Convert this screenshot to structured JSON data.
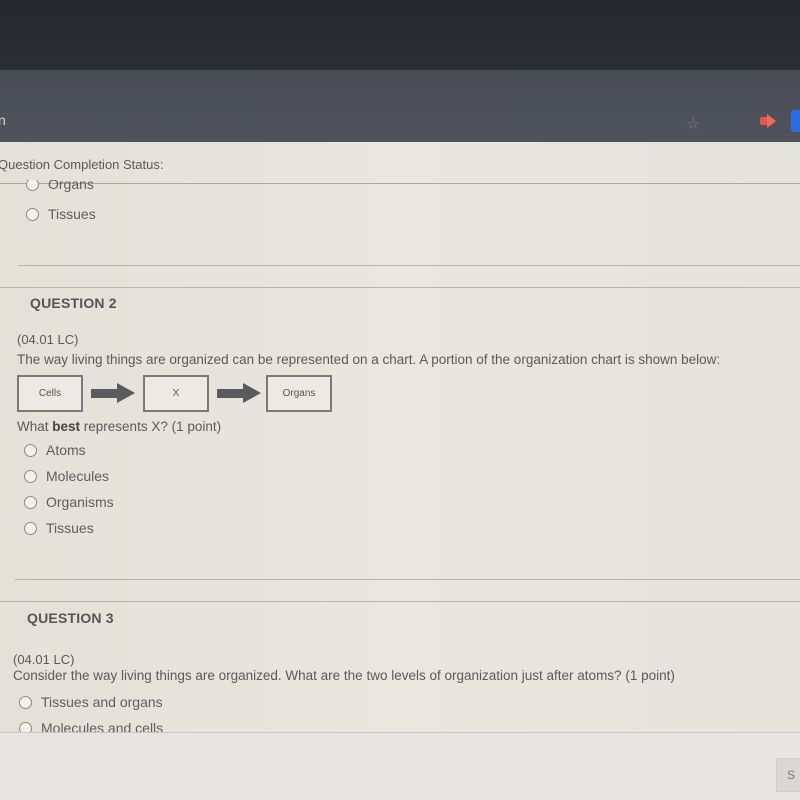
{
  "browser": {
    "tab_edge_glyph": "n",
    "star_icon": "☆",
    "extensions": [
      "red-arrow-extension-icon",
      "blue-extension-icon"
    ]
  },
  "status": {
    "label": "Question Completion Status:"
  },
  "question1_tail": {
    "options": [
      "Organs",
      "Tissues"
    ]
  },
  "question2": {
    "title": "QUESTION 2",
    "code": "(04.01 LC)",
    "text": "The way living things are organized can be represented on a chart. A portion of the organization chart is shown below:",
    "chart": {
      "boxes": [
        "Cells",
        "X",
        "Organs"
      ]
    },
    "prompt_pre": "What ",
    "prompt_bold": "best",
    "prompt_post": " represents X? (1 point)",
    "options": [
      "Atoms",
      "Molecules",
      "Organisms",
      "Tissues"
    ]
  },
  "question3": {
    "title": "QUESTION 3",
    "code": "(04.01 LC)",
    "text": "Consider the way living things are organized. What are the two levels of organization just after atoms? (1 point)",
    "options": [
      "Tissues and organs",
      "Molecules and cells"
    ]
  },
  "footer": {
    "save_label": "S"
  }
}
